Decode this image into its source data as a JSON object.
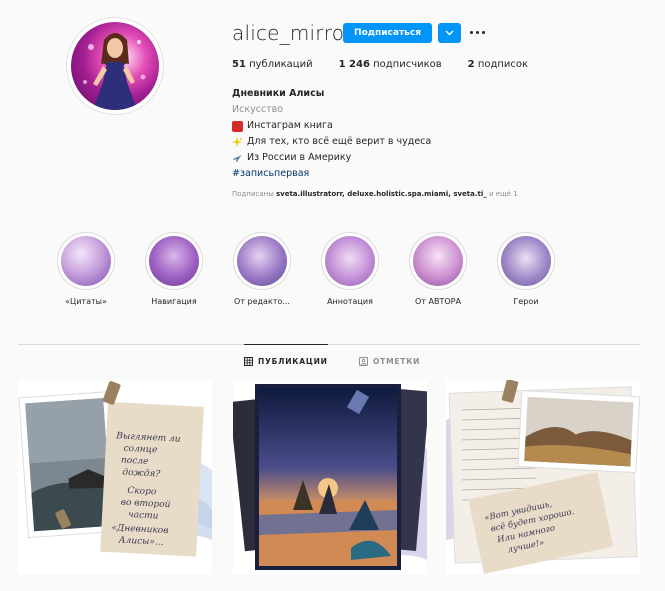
{
  "profile": {
    "username": "alice_mirrors",
    "follow_label": "Подписаться",
    "stats": {
      "posts_count": "51",
      "posts_label": " публикаций",
      "followers_count": "1 246",
      "followers_label": " подписчиков",
      "following_count": "2",
      "following_label": " подписок"
    },
    "bio": {
      "name": "Дневники Алисы",
      "category": "Искусство",
      "line1": "Инстаграм книга",
      "line2": "Для тех, кто всё ещё верит в чудеса",
      "line3": "Из России в Америку",
      "hashtag": "#записьпервая"
    },
    "followed_by": {
      "prefix": "Подписаны ",
      "names": "sveta.illustratorr, deluxe.holistic.spa.miami, sveta.ti_",
      "suffix": " и ещё 1"
    }
  },
  "highlights": [
    {
      "label": "«Цитаты»"
    },
    {
      "label": "Навигация"
    },
    {
      "label": "От редакто..."
    },
    {
      "label": "Аннотация"
    },
    {
      "label": "От АВТОРА"
    },
    {
      "label": "Герои"
    }
  ],
  "tabs": {
    "posts": "ПУБЛИКАЦИИ",
    "tagged": "ОТМЕТКИ"
  },
  "posts": [
    {
      "text": "Выглянет ли солнце после дождя? Скоро во второй части «Дневников Алисы»..."
    },
    {
      "text": ""
    },
    {
      "text": "«Вот увидишь, всё будет хорошо. Или намного лучше!»"
    }
  ],
  "icons": {
    "dropdown": "chevron-down-icon",
    "more": "more-dots-icon",
    "grid": "grid-icon",
    "tag": "tag-icon"
  },
  "colors": {
    "accent": "#0095f6",
    "muted": "#8e8e8e",
    "text": "#262626",
    "hashtag": "#00376b"
  }
}
